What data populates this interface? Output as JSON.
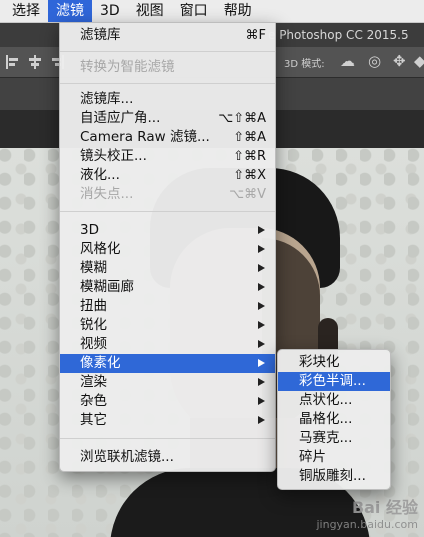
{
  "menubar": {
    "items": [
      "选择",
      "滤镜",
      "3D",
      "视图",
      "窗口",
      "帮助"
    ]
  },
  "titlebar": {
    "text": "e Photoshop CC 2015.5"
  },
  "optionsbar": {
    "mode_label": "3D 模式:"
  },
  "filter_menu": {
    "top": [
      {
        "label": "滤镜库",
        "shortcut": "⌘F",
        "enabled": true
      }
    ],
    "smart": [
      {
        "label": "转换为智能滤镜",
        "enabled": false
      }
    ],
    "special": [
      {
        "label": "滤镜库...",
        "shortcut": "",
        "enabled": true
      },
      {
        "label": "自适应广角...",
        "shortcut": "⌥⇧⌘A",
        "enabled": true
      },
      {
        "label": "Camera Raw 滤镜...",
        "shortcut": "⇧⌘A",
        "enabled": true
      },
      {
        "label": "镜头校正...",
        "shortcut": "⇧⌘R",
        "enabled": true
      },
      {
        "label": "液化...",
        "shortcut": "⇧⌘X",
        "enabled": true
      },
      {
        "label": "消失点...",
        "shortcut": "⌥⌘V",
        "enabled": false
      }
    ],
    "groups": [
      {
        "label": "3D"
      },
      {
        "label": "风格化"
      },
      {
        "label": "模糊"
      },
      {
        "label": "模糊画廊"
      },
      {
        "label": "扭曲"
      },
      {
        "label": "锐化"
      },
      {
        "label": "视频"
      },
      {
        "label": "像素化",
        "highlighted": true
      },
      {
        "label": "渲染"
      },
      {
        "label": "杂色"
      },
      {
        "label": "其它"
      }
    ],
    "browse": {
      "label": "浏览联机滤镜..."
    }
  },
  "pixelate_submenu": {
    "items": [
      {
        "label": "彩块化"
      },
      {
        "label": "彩色半调...",
        "highlighted": true
      },
      {
        "label": "点状化..."
      },
      {
        "label": "晶格化..."
      },
      {
        "label": "马赛克..."
      },
      {
        "label": "碎片"
      },
      {
        "label": "铜版雕刻..."
      }
    ]
  },
  "watermark": {
    "brand": "Bai 经验",
    "url": "jingyan.baidu.com"
  },
  "colors": {
    "highlight": "#2f68d7",
    "menu_bg": "#ececec",
    "disabled_text": "#a7a7a7"
  }
}
